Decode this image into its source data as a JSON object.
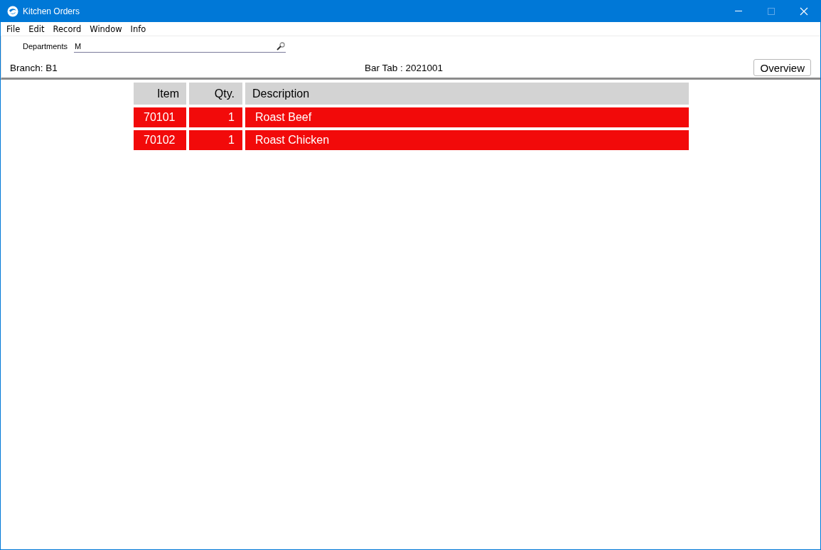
{
  "window": {
    "title": "Kitchen Orders"
  },
  "menu": [
    "File",
    "Edit",
    "Record",
    "Window",
    "Info"
  ],
  "departments": {
    "label": "Departments",
    "value": "M"
  },
  "branch": "Branch: B1",
  "bar_tab": "Bar Tab : 2021001",
  "overview_button": "Overview",
  "table": {
    "columns": [
      "Item",
      "Qty.",
      "Description"
    ],
    "rows": [
      {
        "cells": [
          "70101",
          "1",
          "Roast Beef"
        ],
        "color": "#f20a0a"
      },
      {
        "cells": [
          "70102",
          "1",
          "Roast Chicken"
        ],
        "color": "#f20a0a"
      }
    ]
  }
}
